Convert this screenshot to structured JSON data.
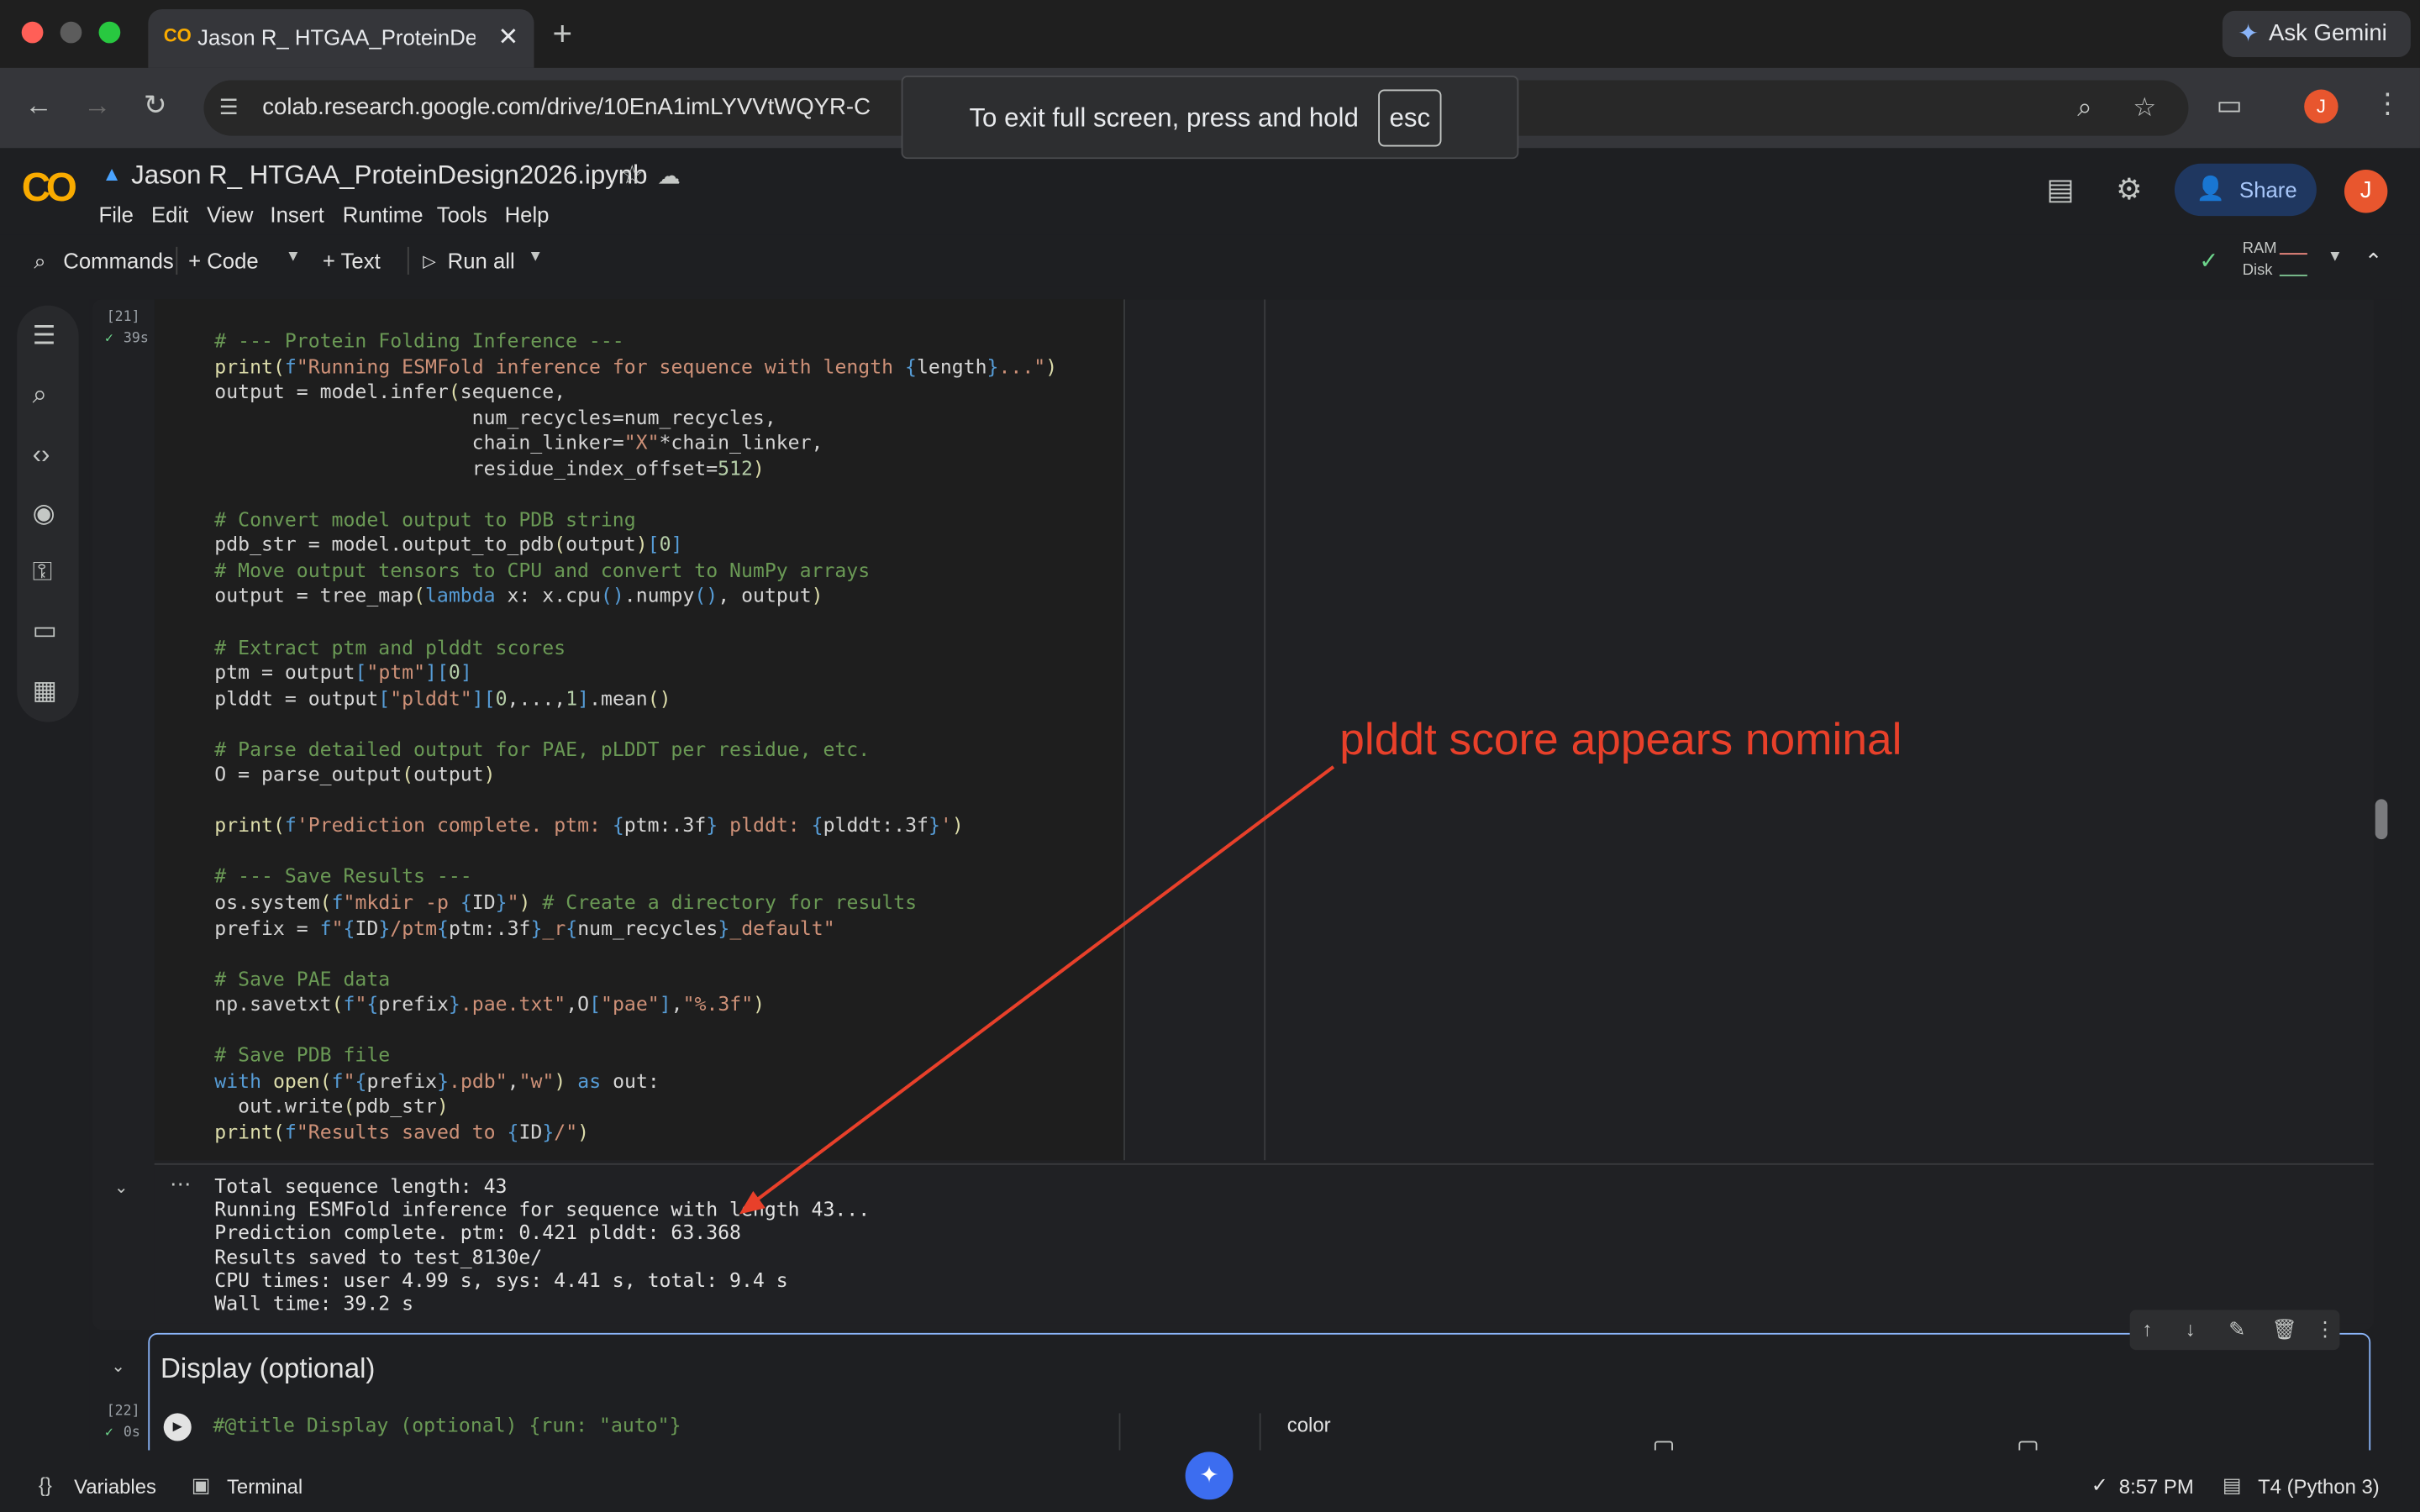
{
  "browser": {
    "tab_title": "Jason R_ HTGAA_ProteinDesi",
    "tab_favicon": "CO",
    "tab_close": "✕",
    "new_tab": "+",
    "ask_gemini": "Ask Gemini",
    "url": "colab.research.google.com/drive/10EnA1imLYVVtWQYR-C",
    "profile_initial": "J"
  },
  "toast": {
    "text": "To exit full screen, press and hold",
    "key": "esc"
  },
  "notebook": {
    "logo": "CO",
    "title": "Jason R_ HTGAA_ProteinDesign2026.ipynb",
    "menu": [
      "File",
      "Edit",
      "View",
      "Insert",
      "Runtime",
      "Tools",
      "Help"
    ],
    "share_label": "Share",
    "user_initial": "J"
  },
  "toolbar": {
    "commands": "Commands",
    "code": "+ Code",
    "text": "+ Text",
    "run_all": "Run all",
    "ram": "RAM",
    "disk": "Disk"
  },
  "cell21": {
    "exec_count": "[21]",
    "duration": "39s",
    "output_lines": [
      "Total sequence length: 43",
      "Running ESMFold inference for sequence with length 43...",
      "Prediction complete. ptm: 0.421 plddt: 63.368",
      "Results saved to test_8130e/",
      "CPU times: user 4.99 s, sys: 4.41 s, total: 9.4 s",
      "Wall time: 39.2 s"
    ]
  },
  "cell22": {
    "section_title": "Display (optional)",
    "exec_count": "[22]",
    "duration": "0s",
    "code_first_line": "#@title Display (optional) {run: \"auto\"}",
    "form_label": "color"
  },
  "annotation": {
    "text": "plddt score appears nominal",
    "color": "#e8402a"
  },
  "statusbar": {
    "variables": "Variables",
    "terminal": "Terminal",
    "time": "8:57 PM",
    "runtime": "T4 (Python 3)"
  }
}
